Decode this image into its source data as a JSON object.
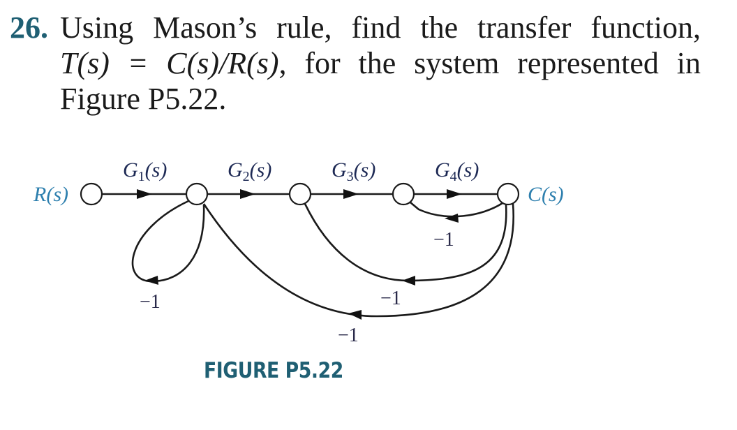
{
  "problem": {
    "number": "26.",
    "line1": "Using Mason’s rule, find the transfer function,",
    "line2_prefix": "T(s) = C(s)/R(s),",
    "line2_suffix": " for the system represented in",
    "line3": "Figure P5.22."
  },
  "figure": {
    "caption": "FIGURE P5.22",
    "input_label": "R(s)",
    "output_label": "C(s)",
    "forward_gains": [
      {
        "name": "G",
        "sub": "1",
        "arg": "(s)"
      },
      {
        "name": "G",
        "sub": "2",
        "arg": "(s)"
      },
      {
        "name": "G",
        "sub": "3",
        "arg": "(s)"
      },
      {
        "name": "G",
        "sub": "4",
        "arg": "(s)"
      }
    ],
    "feedback_gains": {
      "self_loop_node2": "−1",
      "c_to_node4": "−1",
      "c_to_node3": "−1",
      "c_to_node2": "−1"
    },
    "colors": {
      "accent": "#1f5f73",
      "io_label": "#2d7fae",
      "gain_label": "#1e2a55"
    }
  }
}
